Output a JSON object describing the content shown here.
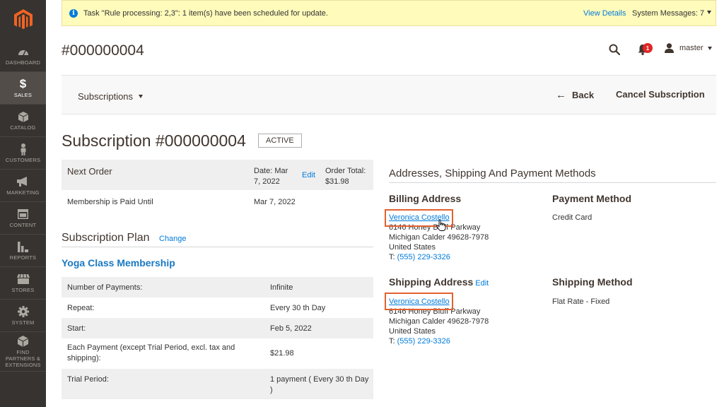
{
  "sidebar": {
    "items": [
      {
        "label": "Dashboard",
        "icon": "dashboard-icon"
      },
      {
        "label": "Sales",
        "icon": "dollar-icon",
        "active": true
      },
      {
        "label": "Catalog",
        "icon": "box-icon"
      },
      {
        "label": "Customers",
        "icon": "person-icon"
      },
      {
        "label": "Marketing",
        "icon": "megaphone-icon"
      },
      {
        "label": "Content",
        "icon": "layout-icon"
      },
      {
        "label": "Reports",
        "icon": "bar-chart-icon"
      },
      {
        "label": "Stores",
        "icon": "store-icon"
      },
      {
        "label": "System",
        "icon": "gear-icon"
      },
      {
        "label": "Find Partners & Extensions",
        "icon": "cube-icon"
      }
    ]
  },
  "message": {
    "text": "Task \"Rule processing: 2,3\": 1 item(s) have been scheduled for update.",
    "view_details": "View Details",
    "system_messages": "System Messages: 7"
  },
  "header": {
    "title": "#000000004",
    "notifications_count": "1",
    "user": "master"
  },
  "actions": {
    "switcher": "Subscriptions",
    "back": "Back",
    "cancel": "Cancel Subscription"
  },
  "subscription": {
    "title": "Subscription #000000004",
    "status": "ACTIVE"
  },
  "next_order": {
    "heading": "Next Order",
    "date": "Date: Mar 7, 2022",
    "edit": "Edit",
    "total": "Order Total: $31.98"
  },
  "paid_until": {
    "label": "Membership is Paid Until",
    "value": "Mar 7, 2022"
  },
  "plan": {
    "heading": "Subscription Plan",
    "change": "Change",
    "name": "Yoga Class Membership",
    "rows": [
      {
        "label": "Number of Payments:",
        "value": "Infinite"
      },
      {
        "label": "Repeat:",
        "value": "Every 30 th Day"
      },
      {
        "label": "Start:",
        "value": "Feb 5, 2022"
      },
      {
        "label": "Each Payment (except Trial Period, excl. tax and shipping):",
        "value": "$21.98"
      },
      {
        "label": "Trial Period:",
        "value": "1 payment ( Every 30 th Day )"
      }
    ]
  },
  "addresses": {
    "heading": "Addresses, Shipping And Payment Methods",
    "billing": {
      "heading": "Billing Address",
      "name": "Veronica Costello",
      "street": "6146 Honey Bluff Parkway",
      "city": "Michigan  Calder  49628-7978",
      "country": "United States",
      "phone_prefix": "T: ",
      "phone": "(555) 229-3326"
    },
    "payment": {
      "heading": "Payment Method",
      "value": "Credit Card"
    },
    "shipping": {
      "heading": "Shipping Address",
      "edit": "Edit",
      "name": "Veronica Costello",
      "street": "6146 Honey Bluff Parkway",
      "city": "Michigan  Calder  49628-7978",
      "country": "United States",
      "phone_prefix": "T: ",
      "phone": "(555) 229-3326"
    },
    "shipping_method": {
      "heading": "Shipping Method",
      "value": "Flat Rate - Fixed"
    }
  },
  "colors": {
    "sidebar_bg": "#373330",
    "link": "#007bdb",
    "highlight": "#e2612f",
    "logo": "#f26322"
  }
}
